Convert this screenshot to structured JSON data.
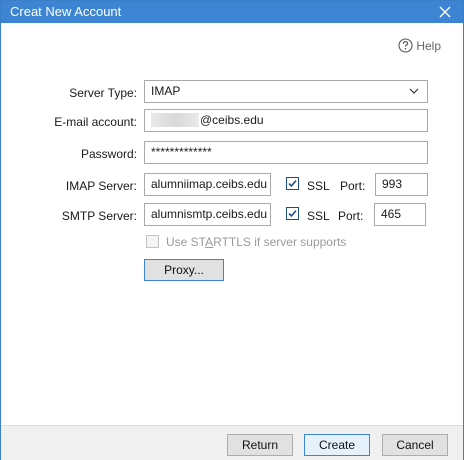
{
  "window": {
    "title": "Creat New Account"
  },
  "help": {
    "label": "Help"
  },
  "form": {
    "server_type": {
      "label": "Server Type:",
      "value": "IMAP"
    },
    "email": {
      "label": "E-mail account:",
      "value": "@ceibs.edu"
    },
    "password": {
      "label": "Password:",
      "value": "*************"
    },
    "imap": {
      "label": "IMAP Server:",
      "value": "alumniimap.ceibs.edu",
      "ssl_label": "SSL",
      "ssl_checked": true,
      "port_label": "Port:",
      "port": "993"
    },
    "smtp": {
      "label": "SMTP Server:",
      "value": "alumnismtp.ceibs.edu",
      "ssl_label": "SSL",
      "ssl_checked": true,
      "port_label": "Port:",
      "port": "465"
    },
    "starttls": {
      "label_before": "Use ST",
      "label_underlined": "A",
      "label_after": "RTTLS if server supports",
      "checked": false,
      "enabled": false
    },
    "proxy_button": "Proxy..."
  },
  "footer": {
    "return_label": "Return",
    "create_label": "Create",
    "cancel_label": "Cancel"
  },
  "colors": {
    "titlebar": "#3d85d3",
    "checkbox_mark": "#1a4f8a"
  }
}
